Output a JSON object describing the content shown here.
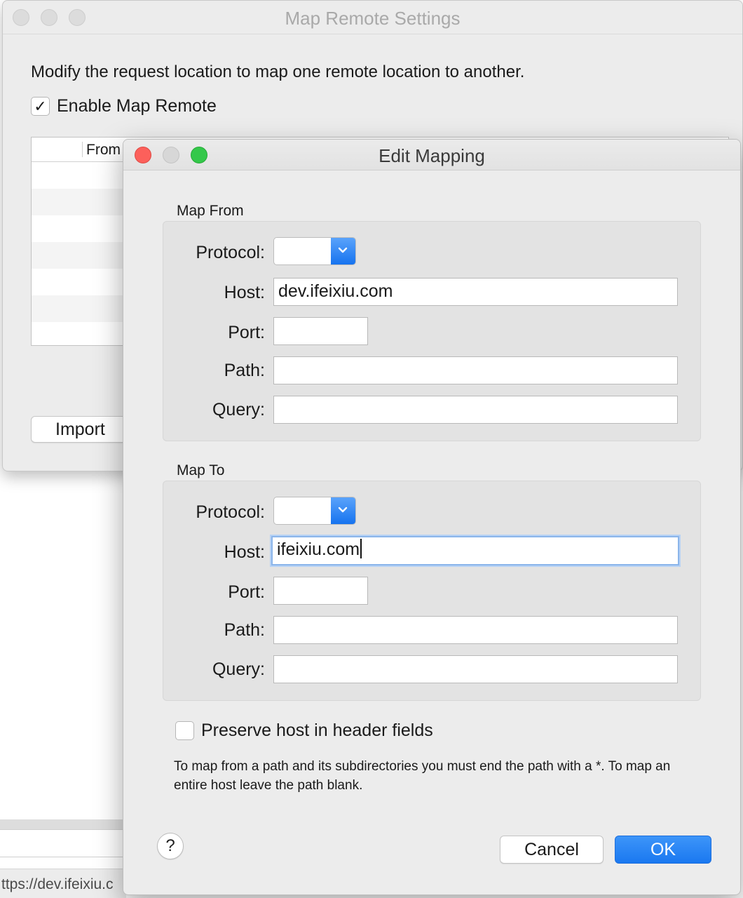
{
  "background_window": {
    "title": "Map Remote Settings",
    "description": "Modify the request location to map one remote location to another.",
    "enable_label": "Enable Map Remote",
    "enable_checked": true,
    "table_column_from": "From",
    "import_label": "Import",
    "status_url": "ttps://dev.ifeixiu.c"
  },
  "dialog": {
    "title": "Edit Mapping",
    "map_from": {
      "section_title": "Map From",
      "protocol_label": "Protocol:",
      "protocol_value": "",
      "host_label": "Host:",
      "host_value": "dev.ifeixiu.com",
      "port_label": "Port:",
      "port_value": "",
      "path_label": "Path:",
      "path_value": "",
      "query_label": "Query:",
      "query_value": ""
    },
    "map_to": {
      "section_title": "Map To",
      "protocol_label": "Protocol:",
      "protocol_value": "",
      "host_label": "Host:",
      "host_value": "ifeixiu.com",
      "port_label": "Port:",
      "port_value": "",
      "path_label": "Path:",
      "path_value": "",
      "query_label": "Query:",
      "query_value": ""
    },
    "preserve_label": "Preserve host in header fields",
    "preserve_checked": false,
    "hint": "To map from a path and its subdirectories you must end the path with a *. To map an entire host leave the path blank.",
    "help_label": "?",
    "cancel_label": "Cancel",
    "ok_label": "OK"
  },
  "colors": {
    "accent": "#1a78f0",
    "close": "#fc605b",
    "zoom": "#34c84a",
    "focus_ring": "#8bb5ea"
  },
  "icons": {
    "check": "checkmark-icon",
    "dropdown": "chevron-down-icon",
    "help": "question-mark-icon"
  }
}
